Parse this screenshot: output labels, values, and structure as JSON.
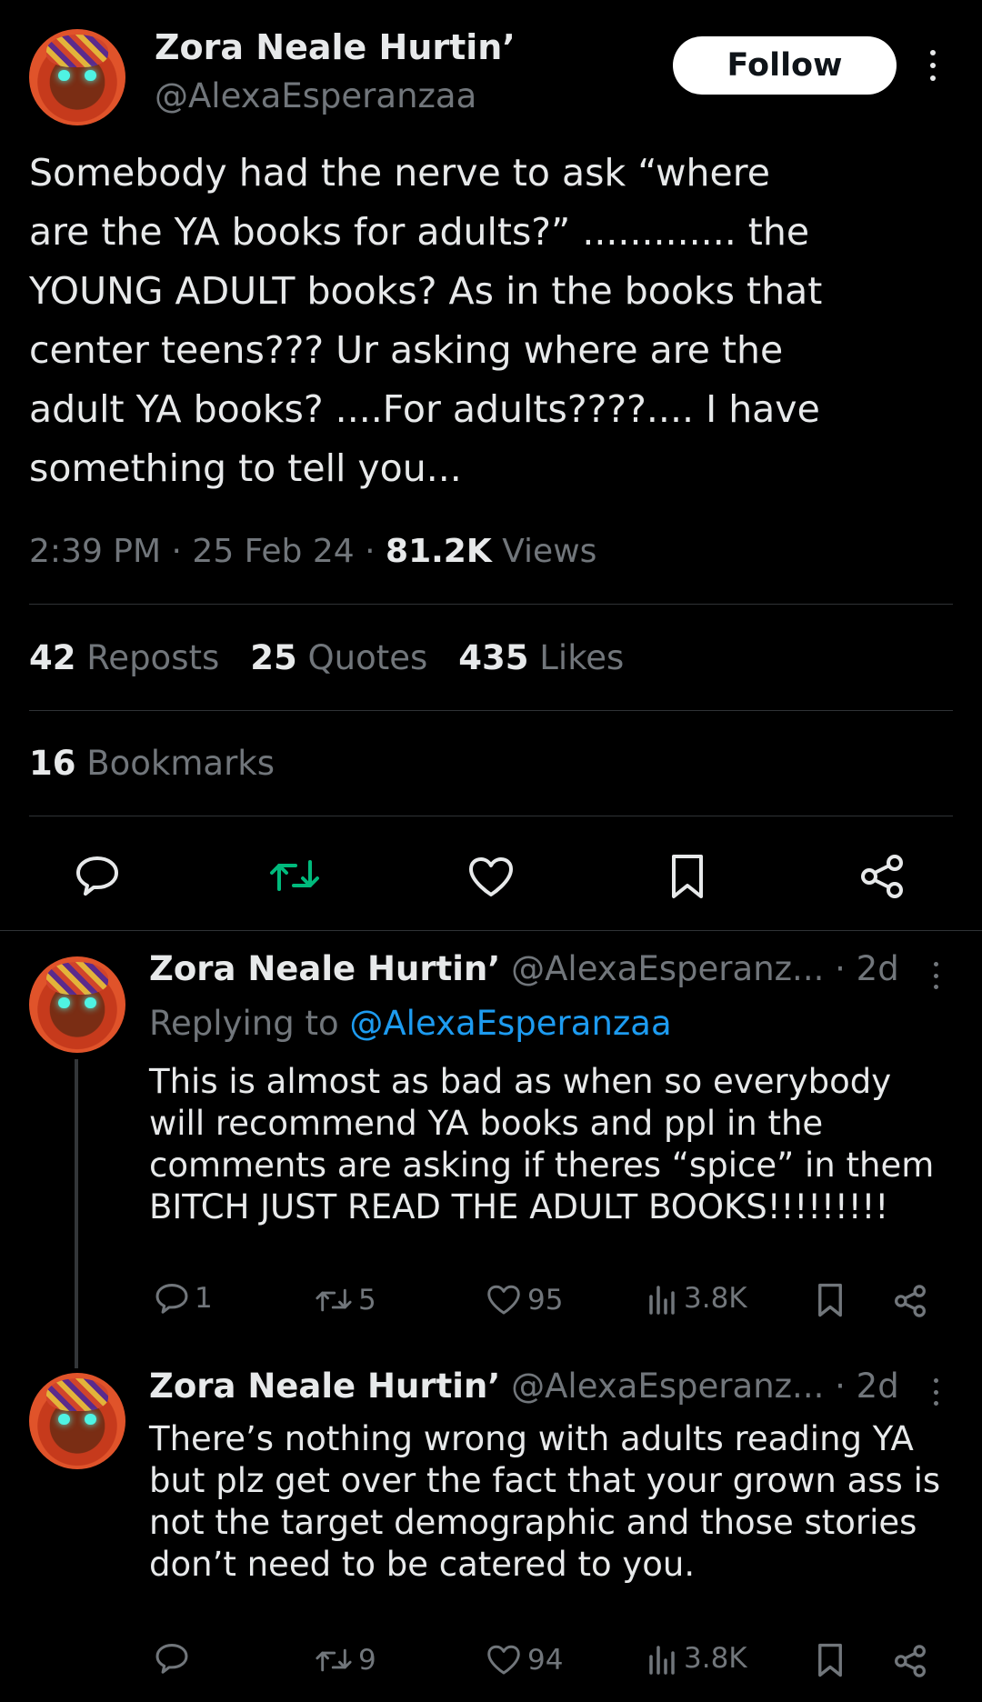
{
  "tweet": {
    "author_name": "Zora Neale Hurtin’",
    "author_handle": "@AlexaEsperanzaa",
    "follow_label": "Follow",
    "text": "Somebody had the nerve to ask “where\nare the YA books for adults?” ............. the\nYOUNG ADULT books? As in the books that\ncenter teens??? Ur asking where are the\nadult YA books? ....For adults????.... I have\nsomething to tell you...",
    "time": "2:39 PM",
    "date": "25 Feb 24",
    "views_count": "81.2K",
    "views_label": "Views",
    "sep": "·",
    "reposts_count": "42",
    "reposts_label": "Reposts",
    "quotes_count": "25",
    "quotes_label": "Quotes",
    "likes_count": "435",
    "likes_label": "Likes",
    "bookmarks_count": "16",
    "bookmarks_label": "Bookmarks",
    "actions": [
      "reply-icon",
      "retweet-icon",
      "heart-icon",
      "bookmark-icon",
      "share-icon"
    ],
    "retweet_color": "#00ba7c"
  },
  "replies": [
    {
      "author_name": "Zora Neale Hurtin’",
      "author_handle": "@AlexaEsperanz...",
      "age": "· 2d",
      "replying_prefix": "Replying to",
      "replying_to": "@AlexaEsperanzaa",
      "text": "This is almost as bad as when so everybody\nwill recommend YA books and ppl in the\ncomments are asking if theres “spice” in them\nBITCH JUST READ THE ADULT BOOKS!!!!!!!!!",
      "reply_count": "1",
      "repost_count": "5",
      "like_count": "95",
      "view_count": "3.8K"
    },
    {
      "author_name": "Zora Neale Hurtin’",
      "author_handle": "@AlexaEsperanz...",
      "age": "· 2d",
      "text": "There’s nothing wrong with adults reading YA\nbut plz get over the fact that your grown ass is\nnot the target demographic and those stories\ndon’t need to be catered to you.",
      "reply_count": "",
      "repost_count": "9",
      "like_count": "94",
      "view_count": "3.8K"
    }
  ],
  "colors": {
    "background": "#000000",
    "text": "#e7e9ea",
    "muted": "#71767b",
    "link": "#1d9bf0",
    "divider": "#2f3336"
  }
}
